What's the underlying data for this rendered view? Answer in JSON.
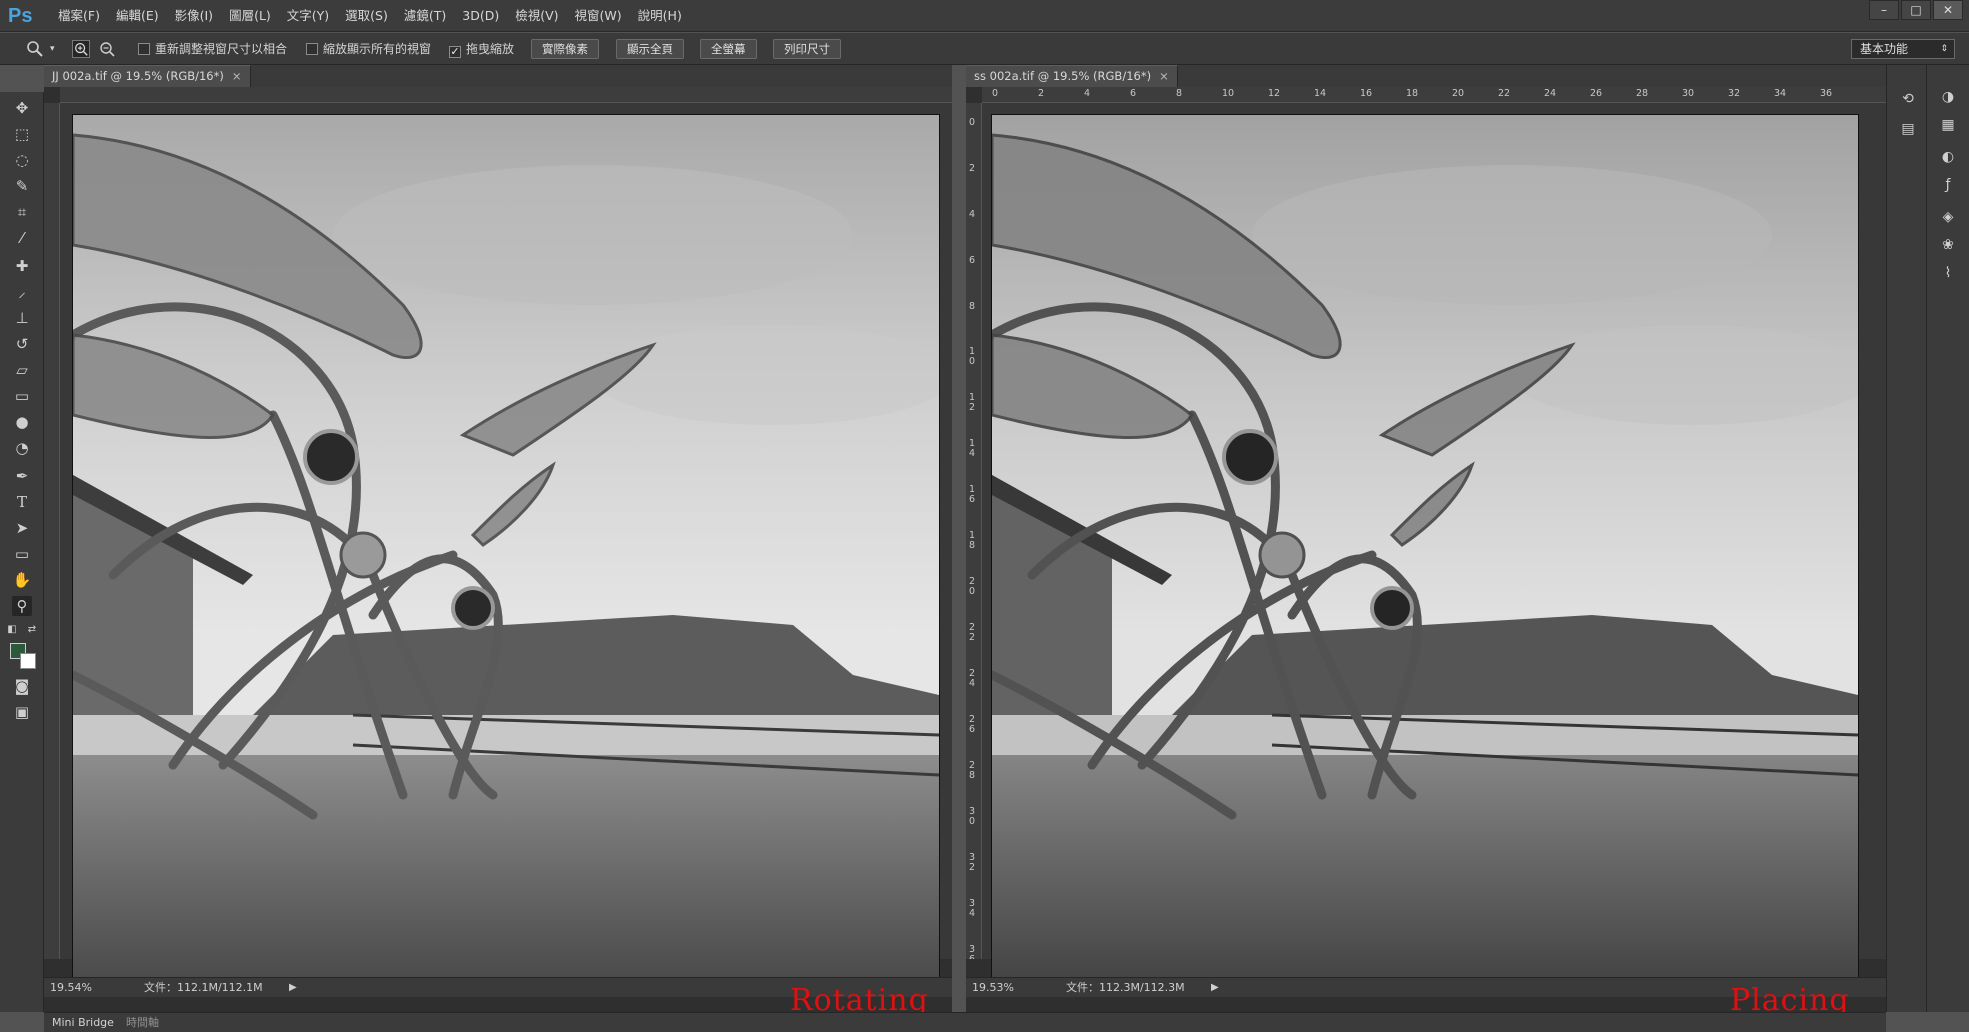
{
  "app": {
    "logo": "Ps"
  },
  "menu": [
    "檔案(F)",
    "編輯(E)",
    "影像(I)",
    "圖層(L)",
    "文字(Y)",
    "選取(S)",
    "濾鏡(T)",
    "3D(D)",
    "檢視(V)",
    "視窗(W)",
    "說明(H)"
  ],
  "window_controls": {
    "minimize": "–",
    "maximize": "□",
    "close": "✕"
  },
  "options": {
    "resize_windows_label": "重新調整視窗尺寸以相合",
    "resize_windows_checked": false,
    "zoom_all_label": "縮放顯示所有的視窗",
    "zoom_all_checked": false,
    "scrubby_zoom_label": "拖曳縮放",
    "scrubby_zoom_checked": true,
    "check": "✓",
    "btn_actual_pixels": "實際像素",
    "btn_fit_screen": "顯示全頁",
    "btn_fill_screen": "全螢幕",
    "btn_print_size": "列印尺寸",
    "workspace": "基本功能"
  },
  "documents": [
    {
      "tab_title": "JJ 002a.tif @ 19.5% (RGB/16*)",
      "zoom": "19.54%",
      "file_info": "文件：112.1M/112.1M",
      "overlay_label": "Rotating"
    },
    {
      "tab_title": "ss 002a.tif @ 19.5% (RGB/16*)",
      "zoom": "19.53%",
      "file_info": "文件：112.3M/112.3M",
      "overlay_label": "Placing"
    }
  ],
  "ruler_top_labels": [
    "0",
    "2",
    "4",
    "6",
    "8",
    "10",
    "12",
    "14",
    "16",
    "18",
    "20",
    "22",
    "24",
    "26",
    "28",
    "30",
    "32",
    "34",
    "36"
  ],
  "ruler_left_labels": [
    "0",
    "2",
    "4",
    "6",
    "8",
    "10",
    "12",
    "14",
    "16",
    "18",
    "20",
    "22",
    "24",
    "26",
    "28",
    "30",
    "32",
    "34",
    "36"
  ],
  "bottom_tabs": {
    "mini_bridge": "Mini Bridge",
    "timeline": "時間軸"
  },
  "icons": {
    "tools": [
      "move-icon",
      "marquee-icon",
      "lasso-icon",
      "quick-select-icon",
      "crop-icon",
      "eyedropper-icon",
      "healing-brush-icon",
      "brush-icon",
      "clone-stamp-icon",
      "history-brush-icon",
      "eraser-icon",
      "gradient-icon",
      "blur-icon",
      "dodge-icon",
      "pen-icon",
      "type-icon",
      "path-select-icon",
      "shape-icon",
      "hand-icon",
      "zoom-icon"
    ]
  },
  "colors": {
    "foreground": "#2a5a3a",
    "background": "#ffffff",
    "label_red": "#e11010",
    "ps_blue": "#4ba3e0"
  }
}
